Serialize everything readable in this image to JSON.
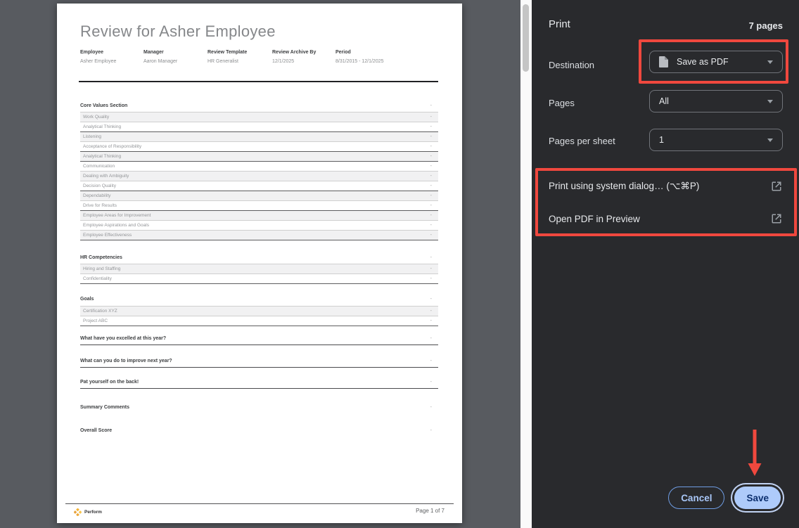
{
  "colors": {
    "annotation_red": "#f0483e",
    "save_button_fill": "#aecbfa",
    "panel_background": "#292a2d"
  },
  "preview": {
    "document": {
      "title": "Review for Asher Employee",
      "meta": [
        {
          "label": "Employee",
          "value": "Asher Employee"
        },
        {
          "label": "Manager",
          "value": "Aaron Manager"
        },
        {
          "label": "Review Template",
          "value": "HR Generalist"
        },
        {
          "label": "Review Archive By",
          "value": "12/1/2025"
        },
        {
          "label": "Period",
          "value": "8/31/2015 - 12/1/2025"
        }
      ],
      "row_marker": "-",
      "sections": [
        {
          "title": "Core Values Section",
          "rows": [
            "Work Quality",
            "Analytical Thinking",
            "Listening",
            "Acceptance of Responsibility",
            "Analytical Thinking",
            "Communication",
            "Dealing with Ambiguity",
            "Decision Quality",
            "Dependability",
            "Drive for Results",
            "Employee Areas for Improvement",
            "Employee Aspirations and Goals",
            "Employee Effectiveness"
          ]
        },
        {
          "title": "HR Competencies",
          "rows": [
            "Hiring and Staffing",
            "Confidentiality"
          ]
        },
        {
          "title": "Goals",
          "rows": [
            "Certification XYZ",
            "Project ABC"
          ]
        }
      ],
      "questions": [
        "What have you excelled at this year?",
        "What can you do to improve next year?",
        "Pat yourself on the back!"
      ],
      "summary_label": "Summary Comments",
      "overall_label": "Overall Score",
      "footer": {
        "brand": "Perform",
        "page_indicator": "Page 1 of 7"
      }
    }
  },
  "panel": {
    "title": "Print",
    "pages_count": "7 pages",
    "fields": [
      {
        "label": "Destination",
        "value": "Save as PDF",
        "icon": "pdf-file-icon"
      },
      {
        "label": "Pages",
        "value": "All"
      },
      {
        "label": "Pages per sheet",
        "value": "1"
      }
    ],
    "links": [
      {
        "label": "Print using system dialog… (⌥⌘P)",
        "icon": "open-in-new-icon"
      },
      {
        "label": "Open PDF in Preview",
        "icon": "open-in-new-icon"
      }
    ],
    "buttons": {
      "cancel": "Cancel",
      "save": "Save"
    }
  }
}
